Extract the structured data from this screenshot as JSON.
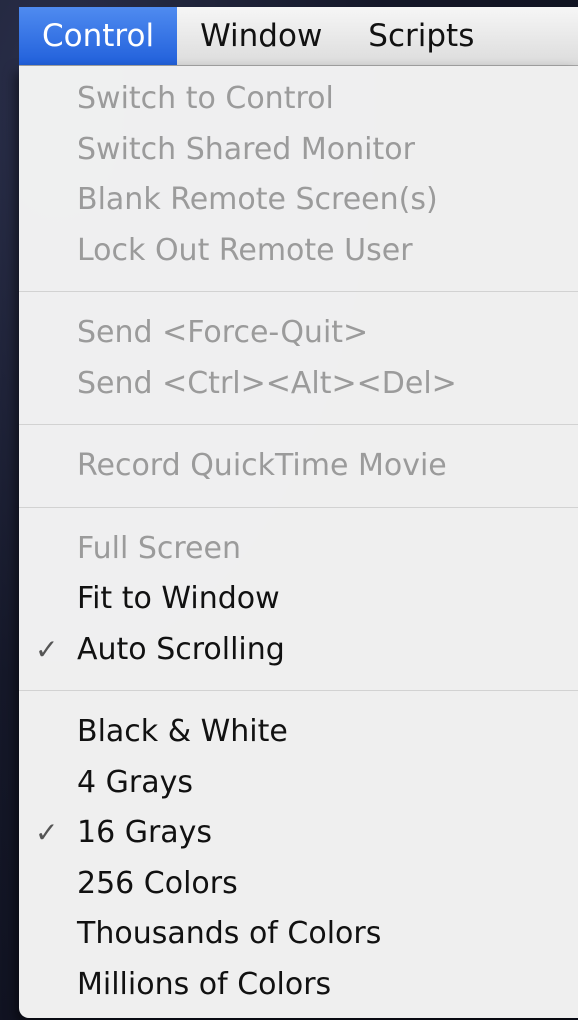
{
  "menubar": {
    "items": [
      {
        "label": "Control"
      },
      {
        "label": "Window"
      },
      {
        "label": "Scripts"
      }
    ]
  },
  "menu": {
    "check_glyph": "✓",
    "groups": [
      {
        "items": [
          {
            "label": "Switch to Control",
            "enabled": false,
            "checked": false
          },
          {
            "label": "Switch Shared Monitor",
            "enabled": false,
            "checked": false
          },
          {
            "label": "Blank Remote Screen(s)",
            "enabled": false,
            "checked": false
          },
          {
            "label": "Lock Out Remote User",
            "enabled": false,
            "checked": false
          }
        ]
      },
      {
        "items": [
          {
            "label": "Send <Force-Quit>",
            "enabled": false,
            "checked": false
          },
          {
            "label": "Send <Ctrl><Alt><Del>",
            "enabled": false,
            "checked": false
          }
        ]
      },
      {
        "items": [
          {
            "label": "Record QuickTime Movie",
            "enabled": false,
            "checked": false
          }
        ]
      },
      {
        "items": [
          {
            "label": "Full Screen",
            "enabled": false,
            "checked": false
          },
          {
            "label": "Fit to Window",
            "enabled": true,
            "checked": false
          },
          {
            "label": "Auto Scrolling",
            "enabled": true,
            "checked": true
          }
        ]
      },
      {
        "items": [
          {
            "label": "Black & White",
            "enabled": true,
            "checked": false
          },
          {
            "label": "4 Grays",
            "enabled": true,
            "checked": false
          },
          {
            "label": "16 Grays",
            "enabled": true,
            "checked": true
          },
          {
            "label": "256 Colors",
            "enabled": true,
            "checked": false
          },
          {
            "label": "Thousands of Colors",
            "enabled": true,
            "checked": false
          },
          {
            "label": "Millions of Colors",
            "enabled": true,
            "checked": false
          }
        ]
      }
    ]
  }
}
